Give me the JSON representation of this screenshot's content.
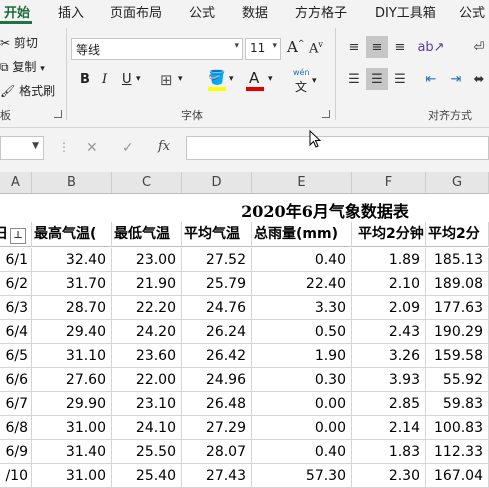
{
  "ribbon_tabs": [
    "开始",
    "插入",
    "页面布局",
    "公式",
    "数据",
    "方方格子",
    "DIY工具箱",
    "公式"
  ],
  "clipboard": {
    "cut": "剪切",
    "copy": "复制",
    "painter": "格式刷",
    "group": "板"
  },
  "font": {
    "name": "等线",
    "size": "11",
    "grow": "A",
    "shrink": "A",
    "bold": "B",
    "italic": "I",
    "underline": "U",
    "group": "字体",
    "pinyin_top": "wén",
    "pinyin_bot": "文"
  },
  "align": {
    "group": "对齐方式"
  },
  "formula_bar": {
    "cancel": "✕",
    "enter": "✓",
    "fx": "fx",
    "value": ""
  },
  "columns": [
    "A",
    "B",
    "C",
    "D",
    "E",
    "F",
    "G"
  ],
  "sheet": {
    "title": "2020年6月气象数据表",
    "headers": [
      "日",
      "最高气温(",
      "最低气温",
      "平均气温",
      "总雨量(mm)",
      "平均2分钟",
      "平均2分"
    ],
    "rows": [
      [
        "6/1",
        "32.40",
        "23.00",
        "27.52",
        "0.40",
        "1.89",
        "185.13"
      ],
      [
        "6/2",
        "31.70",
        "21.90",
        "25.79",
        "22.40",
        "2.10",
        "189.08"
      ],
      [
        "6/3",
        "28.70",
        "22.20",
        "24.76",
        "3.30",
        "2.09",
        "177.63"
      ],
      [
        "6/4",
        "29.40",
        "24.20",
        "26.24",
        "0.50",
        "2.43",
        "190.29"
      ],
      [
        "6/5",
        "31.10",
        "23.60",
        "26.42",
        "1.90",
        "3.26",
        "159.58"
      ],
      [
        "6/6",
        "27.60",
        "22.00",
        "24.96",
        "0.30",
        "3.93",
        "55.92"
      ],
      [
        "6/7",
        "29.90",
        "23.10",
        "26.48",
        "0.00",
        "2.85",
        "59.83"
      ],
      [
        "6/8",
        "31.00",
        "24.10",
        "27.29",
        "0.00",
        "2.14",
        "100.83"
      ],
      [
        "6/9",
        "31.40",
        "25.50",
        "28.07",
        "0.40",
        "1.83",
        "112.33"
      ],
      [
        "/10",
        "31.00",
        "25.40",
        "27.43",
        "57.30",
        "2.30",
        "167.04"
      ]
    ]
  }
}
